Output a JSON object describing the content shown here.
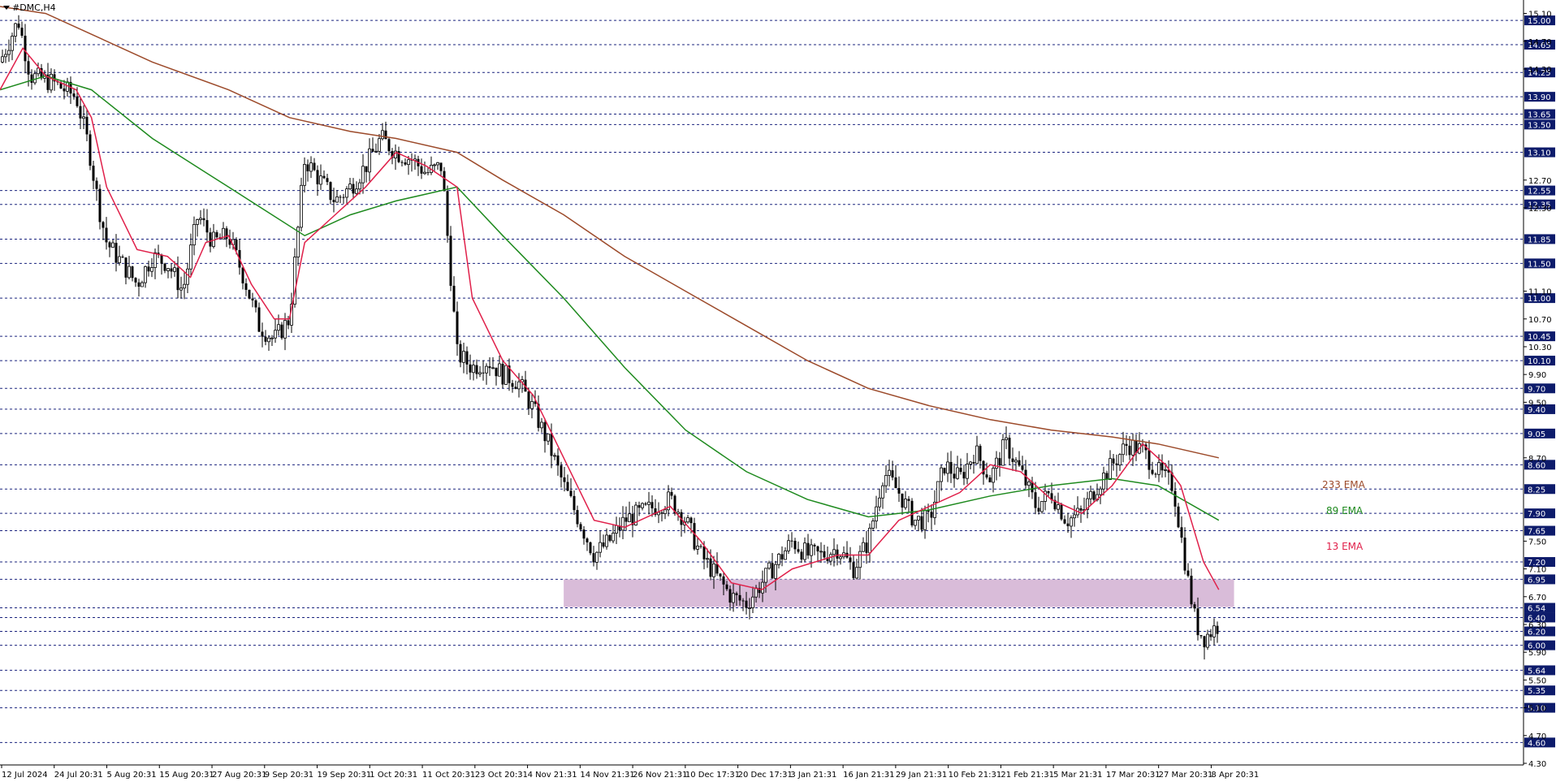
{
  "header": {
    "symbol": "#DMC,H4"
  },
  "colors": {
    "background": "#ffffff",
    "grid": "#1a237e",
    "candle": "#000000",
    "ema13": "#e0204a",
    "ema89": "#1e8a1e",
    "ema233": "#9c4a2a",
    "zone": "#d9bcd9",
    "price_tag_bg": "#0d1b6b",
    "price_tag_text": "#ffffff"
  },
  "legend": {
    "ema233": "233 EMA",
    "ema89": "89 EMA",
    "ema13": "13 EMA"
  },
  "chart_data": {
    "type": "candlestick",
    "x_ticks": [
      "12 Jul 2024",
      "24 Jul 20:31",
      "5 Aug 20:31",
      "15 Aug 20:31",
      "27 Aug 20:31",
      "9 Sep 20:31",
      "19 Sep 20:31",
      "1 Oct 20:31",
      "11 Oct 20:31",
      "23 Oct 20:31",
      "4 Nov 21:31",
      "14 Nov 21:31",
      "26 Nov 21:31",
      "10 Dec 17:31",
      "20 Dec 17:31",
      "3 Jan 21:31",
      "16 Jan 21:31",
      "29 Jan 21:31",
      "10 Feb 21:31",
      "21 Feb 21:31",
      "5 Mar 21:31",
      "17 Mar 20:31",
      "27 Mar 20:31",
      "8 Apr 20:31"
    ],
    "y_axis": {
      "min": 4.3,
      "max": 15.2,
      "labels": [
        "15.10",
        "14.70",
        "14.30",
        "12.70",
        "12.30",
        "11.10",
        "10.70",
        "10.30",
        "9.90",
        "9.50",
        "8.70",
        "7.50",
        "7.10",
        "6.70",
        "6.30",
        "5.90",
        "5.50",
        "5.10",
        "4.70",
        "4.30"
      ],
      "tagged_levels": [
        "15.00",
        "14.65",
        "14.25",
        "13.90",
        "13.65",
        "13.50",
        "13.10",
        "12.55",
        "12.35",
        "11.85",
        "11.50",
        "11.00",
        "10.45",
        "10.10",
        "9.70",
        "9.40",
        "9.05",
        "8.60",
        "8.25",
        "7.90",
        "7.65",
        "7.20",
        "6.95",
        "6.54",
        "6.40",
        "6.20",
        "6.00",
        "5.64",
        "5.35",
        "5.10",
        "4.60"
      ]
    },
    "zone": {
      "from": 6.55,
      "to": 6.95,
      "x_start": 0.37,
      "x_end": 0.81
    },
    "price_path": [
      [
        0.0,
        14.4
      ],
      [
        0.012,
        15.0
      ],
      [
        0.02,
        14.2
      ],
      [
        0.035,
        14.1
      ],
      [
        0.05,
        13.9
      ],
      [
        0.058,
        13.2
      ],
      [
        0.065,
        12.3
      ],
      [
        0.07,
        11.8
      ],
      [
        0.08,
        11.5
      ],
      [
        0.09,
        11.2
      ],
      [
        0.1,
        11.6
      ],
      [
        0.11,
        11.5
      ],
      [
        0.12,
        11.1
      ],
      [
        0.13,
        12.2
      ],
      [
        0.14,
        11.8
      ],
      [
        0.15,
        11.9
      ],
      [
        0.16,
        11.3
      ],
      [
        0.17,
        10.6
      ],
      [
        0.18,
        10.4
      ],
      [
        0.19,
        10.7
      ],
      [
        0.2,
        13.0
      ],
      [
        0.21,
        12.7
      ],
      [
        0.22,
        12.4
      ],
      [
        0.23,
        12.6
      ],
      [
        0.24,
        12.9
      ],
      [
        0.25,
        13.3
      ],
      [
        0.26,
        13.1
      ],
      [
        0.27,
        13.0
      ],
      [
        0.28,
        12.8
      ],
      [
        0.29,
        12.9
      ],
      [
        0.3,
        10.2
      ],
      [
        0.31,
        10.0
      ],
      [
        0.32,
        10.1
      ],
      [
        0.33,
        9.9
      ],
      [
        0.34,
        9.8
      ],
      [
        0.35,
        9.4
      ],
      [
        0.36,
        8.9
      ],
      [
        0.37,
        8.3
      ],
      [
        0.38,
        7.8
      ],
      [
        0.39,
        7.3
      ],
      [
        0.4,
        7.5
      ],
      [
        0.41,
        7.8
      ],
      [
        0.42,
        7.9
      ],
      [
        0.43,
        8.0
      ],
      [
        0.44,
        8.1
      ],
      [
        0.45,
        7.8
      ],
      [
        0.46,
        7.3
      ],
      [
        0.47,
        7.0
      ],
      [
        0.48,
        6.7
      ],
      [
        0.49,
        6.6
      ],
      [
        0.5,
        6.9
      ],
      [
        0.51,
        7.2
      ],
      [
        0.52,
        7.5
      ],
      [
        0.53,
        7.3
      ],
      [
        0.54,
        7.3
      ],
      [
        0.55,
        7.4
      ],
      [
        0.56,
        7.1
      ],
      [
        0.57,
        7.5
      ],
      [
        0.58,
        8.5
      ],
      [
        0.59,
        8.2
      ],
      [
        0.6,
        7.8
      ],
      [
        0.61,
        7.8
      ],
      [
        0.62,
        8.6
      ],
      [
        0.63,
        8.4
      ],
      [
        0.64,
        8.8
      ],
      [
        0.65,
        8.4
      ],
      [
        0.66,
        8.9
      ],
      [
        0.67,
        8.5
      ],
      [
        0.68,
        8.0
      ],
      [
        0.69,
        8.2
      ],
      [
        0.7,
        7.8
      ],
      [
        0.71,
        7.9
      ],
      [
        0.72,
        8.3
      ],
      [
        0.73,
        8.6
      ],
      [
        0.74,
        8.9
      ],
      [
        0.75,
        8.8
      ],
      [
        0.76,
        8.5
      ],
      [
        0.77,
        8.3
      ],
      [
        0.775,
        7.6
      ],
      [
        0.78,
        6.9
      ],
      [
        0.785,
        6.3
      ],
      [
        0.79,
        6.1
      ],
      [
        0.8,
        6.3
      ]
    ],
    "series": [
      {
        "name": "233 EMA",
        "points": [
          [
            0.0,
            15.2
          ],
          [
            0.03,
            15.1
          ],
          [
            0.06,
            14.8
          ],
          [
            0.1,
            14.4
          ],
          [
            0.15,
            14.0
          ],
          [
            0.19,
            13.6
          ],
          [
            0.23,
            13.4
          ],
          [
            0.26,
            13.3
          ],
          [
            0.3,
            13.1
          ],
          [
            0.33,
            12.7
          ],
          [
            0.37,
            12.2
          ],
          [
            0.41,
            11.6
          ],
          [
            0.45,
            11.1
          ],
          [
            0.49,
            10.6
          ],
          [
            0.53,
            10.1
          ],
          [
            0.57,
            9.7
          ],
          [
            0.61,
            9.45
          ],
          [
            0.65,
            9.25
          ],
          [
            0.69,
            9.1
          ],
          [
            0.73,
            9.0
          ],
          [
            0.76,
            8.9
          ],
          [
            0.8,
            8.7
          ]
        ]
      },
      {
        "name": "89 EMA",
        "points": [
          [
            0.0,
            14.0
          ],
          [
            0.03,
            14.2
          ],
          [
            0.06,
            14.0
          ],
          [
            0.1,
            13.3
          ],
          [
            0.15,
            12.6
          ],
          [
            0.2,
            11.9
          ],
          [
            0.23,
            12.2
          ],
          [
            0.26,
            12.4
          ],
          [
            0.3,
            12.6
          ],
          [
            0.33,
            11.9
          ],
          [
            0.37,
            11.0
          ],
          [
            0.41,
            10.0
          ],
          [
            0.45,
            9.1
          ],
          [
            0.49,
            8.5
          ],
          [
            0.53,
            8.1
          ],
          [
            0.57,
            7.85
          ],
          [
            0.61,
            7.95
          ],
          [
            0.65,
            8.15
          ],
          [
            0.69,
            8.3
          ],
          [
            0.73,
            8.4
          ],
          [
            0.76,
            8.3
          ],
          [
            0.8,
            7.8
          ]
        ]
      },
      {
        "name": "13 EMA",
        "points": [
          [
            0.0,
            14.0
          ],
          [
            0.015,
            14.6
          ],
          [
            0.03,
            14.2
          ],
          [
            0.05,
            14.0
          ],
          [
            0.06,
            13.6
          ],
          [
            0.07,
            12.6
          ],
          [
            0.09,
            11.7
          ],
          [
            0.11,
            11.6
          ],
          [
            0.125,
            11.3
          ],
          [
            0.135,
            11.8
          ],
          [
            0.15,
            11.9
          ],
          [
            0.165,
            11.2
          ],
          [
            0.18,
            10.7
          ],
          [
            0.19,
            10.7
          ],
          [
            0.2,
            11.8
          ],
          [
            0.22,
            12.2
          ],
          [
            0.24,
            12.6
          ],
          [
            0.26,
            13.1
          ],
          [
            0.28,
            12.9
          ],
          [
            0.3,
            12.6
          ],
          [
            0.31,
            11.0
          ],
          [
            0.33,
            10.1
          ],
          [
            0.35,
            9.6
          ],
          [
            0.37,
            8.7
          ],
          [
            0.39,
            7.8
          ],
          [
            0.41,
            7.7
          ],
          [
            0.44,
            8.0
          ],
          [
            0.46,
            7.5
          ],
          [
            0.48,
            6.9
          ],
          [
            0.5,
            6.8
          ],
          [
            0.52,
            7.1
          ],
          [
            0.55,
            7.3
          ],
          [
            0.57,
            7.3
          ],
          [
            0.59,
            7.8
          ],
          [
            0.61,
            8.0
          ],
          [
            0.63,
            8.2
          ],
          [
            0.65,
            8.6
          ],
          [
            0.67,
            8.5
          ],
          [
            0.69,
            8.1
          ],
          [
            0.71,
            7.9
          ],
          [
            0.73,
            8.3
          ],
          [
            0.75,
            8.9
          ],
          [
            0.765,
            8.6
          ],
          [
            0.775,
            8.3
          ],
          [
            0.79,
            7.2
          ],
          [
            0.8,
            6.8
          ]
        ]
      }
    ]
  }
}
